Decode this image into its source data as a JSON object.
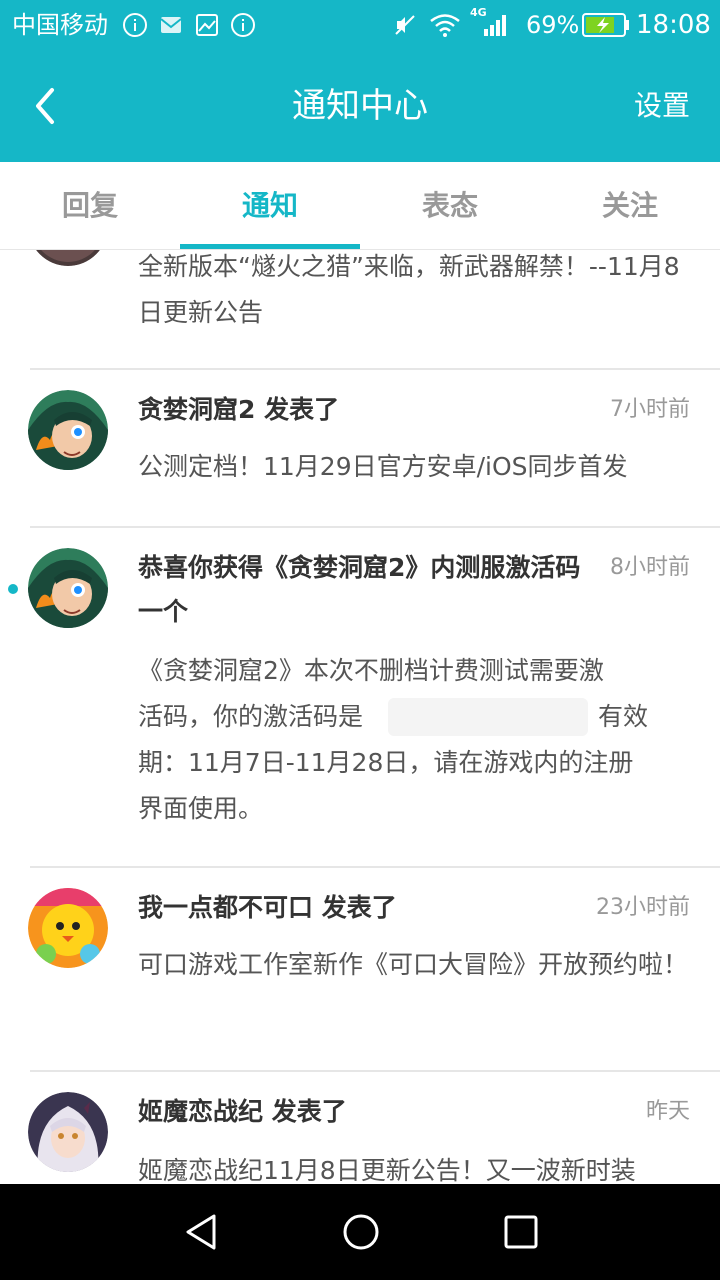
{
  "status_bar": {
    "carrier": "中国移动",
    "network": "4G",
    "battery": "69%",
    "time": "18:08"
  },
  "header": {
    "title": "通知中心",
    "settings_label": "设置"
  },
  "tabs": [
    {
      "label": "回复",
      "active": false
    },
    {
      "label": "通知",
      "active": true
    },
    {
      "label": "表态",
      "active": false
    },
    {
      "label": "关注",
      "active": false
    }
  ],
  "notifications": [
    {
      "title": "",
      "time": "",
      "body": "全新版本“燧火之猎”来临，新武器解禁！--11月8日更新公告",
      "avatar": "partial-avatar",
      "unread": false
    },
    {
      "title": "贪婪洞窟2 发表了",
      "time": "7小时前",
      "body": "公测定档！11月29日官方安卓/iOS同步首发",
      "avatar": "greedy-cave-avatar",
      "unread": false
    },
    {
      "title": "恭喜你获得《贪婪洞窟2》内测服激活码一个",
      "time": "8小时前",
      "body_line_1": "《贪婪洞窟2》本次不删档计费测试需要激",
      "body_line_2_start": "活码，你的激活码是",
      "body_line_2_end": "有效",
      "body_line_3": "期：11月7日-11月28日，请在游戏内的注册",
      "body_line_4": "界面使用。",
      "avatar": "greedy-cave-avatar",
      "unread": true
    },
    {
      "title": "我一点都不可口 发表了",
      "time": "23小时前",
      "body": "可口游戏工作室新作《可口大冒险》开放预约啦！",
      "avatar": "chick-avatar",
      "unread": false
    },
    {
      "title": "姬魔恋战纪 发表了",
      "time": "昨天",
      "body": "姬魔恋战纪11月8日更新公告！又一波新时装",
      "avatar": "anime-girl-avatar",
      "unread": false
    }
  ],
  "nav_bar": {
    "back": "back-triangle-icon",
    "home": "home-circle-icon",
    "recents": "recents-square-icon"
  },
  "colors": {
    "accent": "#15b7c7",
    "unread": "#15b7c7",
    "nav_bar": "#000000"
  }
}
